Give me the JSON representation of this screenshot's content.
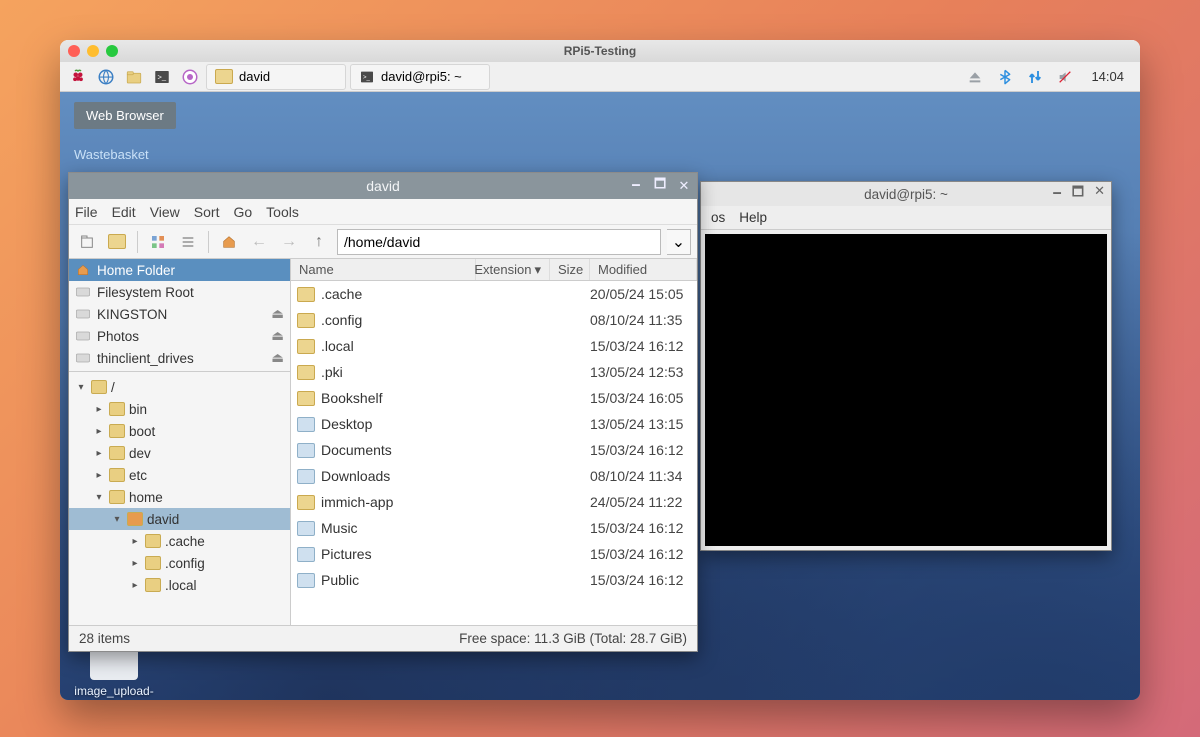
{
  "vm": {
    "title": "RPi5-Testing"
  },
  "panel": {
    "tasks": [
      {
        "icon": "folder",
        "label": "david"
      },
      {
        "icon": "terminal",
        "label": "david@rpi5: ~"
      }
    ],
    "clock": "14:04"
  },
  "desktop": {
    "web_browser": "Web Browser",
    "wastebasket": "Wastebasket",
    "log_icon": "image_upload-\ner.log"
  },
  "fm": {
    "title": "david",
    "menus": [
      "File",
      "Edit",
      "View",
      "Sort",
      "Go",
      "Tools"
    ],
    "path": "/home/david",
    "places": [
      {
        "label": "Home Folder",
        "sel": true,
        "eject": false,
        "icon": "home"
      },
      {
        "label": "Filesystem Root",
        "sel": false,
        "eject": false,
        "icon": "disk"
      },
      {
        "label": "KINGSTON",
        "sel": false,
        "eject": true,
        "icon": "disk"
      },
      {
        "label": "Photos",
        "sel": false,
        "eject": true,
        "icon": "disk"
      },
      {
        "label": "thinclient_drives",
        "sel": false,
        "eject": true,
        "icon": "disk"
      }
    ],
    "tree": [
      {
        "depth": 0,
        "expand": "▾",
        "label": "/",
        "sel": false,
        "home": false
      },
      {
        "depth": 1,
        "expand": "▸",
        "label": "bin",
        "sel": false,
        "home": false
      },
      {
        "depth": 1,
        "expand": "▸",
        "label": "boot",
        "sel": false,
        "home": false
      },
      {
        "depth": 1,
        "expand": "▸",
        "label": "dev",
        "sel": false,
        "home": false
      },
      {
        "depth": 1,
        "expand": "▸",
        "label": "etc",
        "sel": false,
        "home": false
      },
      {
        "depth": 1,
        "expand": "▾",
        "label": "home",
        "sel": false,
        "home": false
      },
      {
        "depth": 2,
        "expand": "▾",
        "label": "david",
        "sel": true,
        "home": true
      },
      {
        "depth": 3,
        "expand": "▸",
        "label": ".cache",
        "sel": false,
        "home": false
      },
      {
        "depth": 3,
        "expand": "▸",
        "label": ".config",
        "sel": false,
        "home": false
      },
      {
        "depth": 3,
        "expand": "▸",
        "label": ".local",
        "sel": false,
        "home": false
      }
    ],
    "columns": {
      "name": "Name",
      "ext": "Extension",
      "size": "Size",
      "mod": "Modified"
    },
    "rows": [
      {
        "name": ".cache",
        "mod": "20/05/24 15:05",
        "special": false
      },
      {
        "name": ".config",
        "mod": "08/10/24 11:35",
        "special": false
      },
      {
        "name": ".local",
        "mod": "15/03/24 16:12",
        "special": false
      },
      {
        "name": ".pki",
        "mod": "13/05/24 12:53",
        "special": false
      },
      {
        "name": "Bookshelf",
        "mod": "15/03/24 16:05",
        "special": false
      },
      {
        "name": "Desktop",
        "mod": "13/05/24 13:15",
        "special": true
      },
      {
        "name": "Documents",
        "mod": "15/03/24 16:12",
        "special": true
      },
      {
        "name": "Downloads",
        "mod": "08/10/24 11:34",
        "special": true
      },
      {
        "name": "immich-app",
        "mod": "24/05/24 11:22",
        "special": false
      },
      {
        "name": "Music",
        "mod": "15/03/24 16:12",
        "special": true
      },
      {
        "name": "Pictures",
        "mod": "15/03/24 16:12",
        "special": true
      },
      {
        "name": "Public",
        "mod": "15/03/24 16:12",
        "special": true
      }
    ],
    "status_left": "28 items",
    "status_right": "Free space: 11.3 GiB (Total: 28.7 GiB)"
  },
  "term": {
    "title": "david@rpi5: ~",
    "menus_visible": [
      "os",
      "Help"
    ],
    "prompt": ""
  }
}
